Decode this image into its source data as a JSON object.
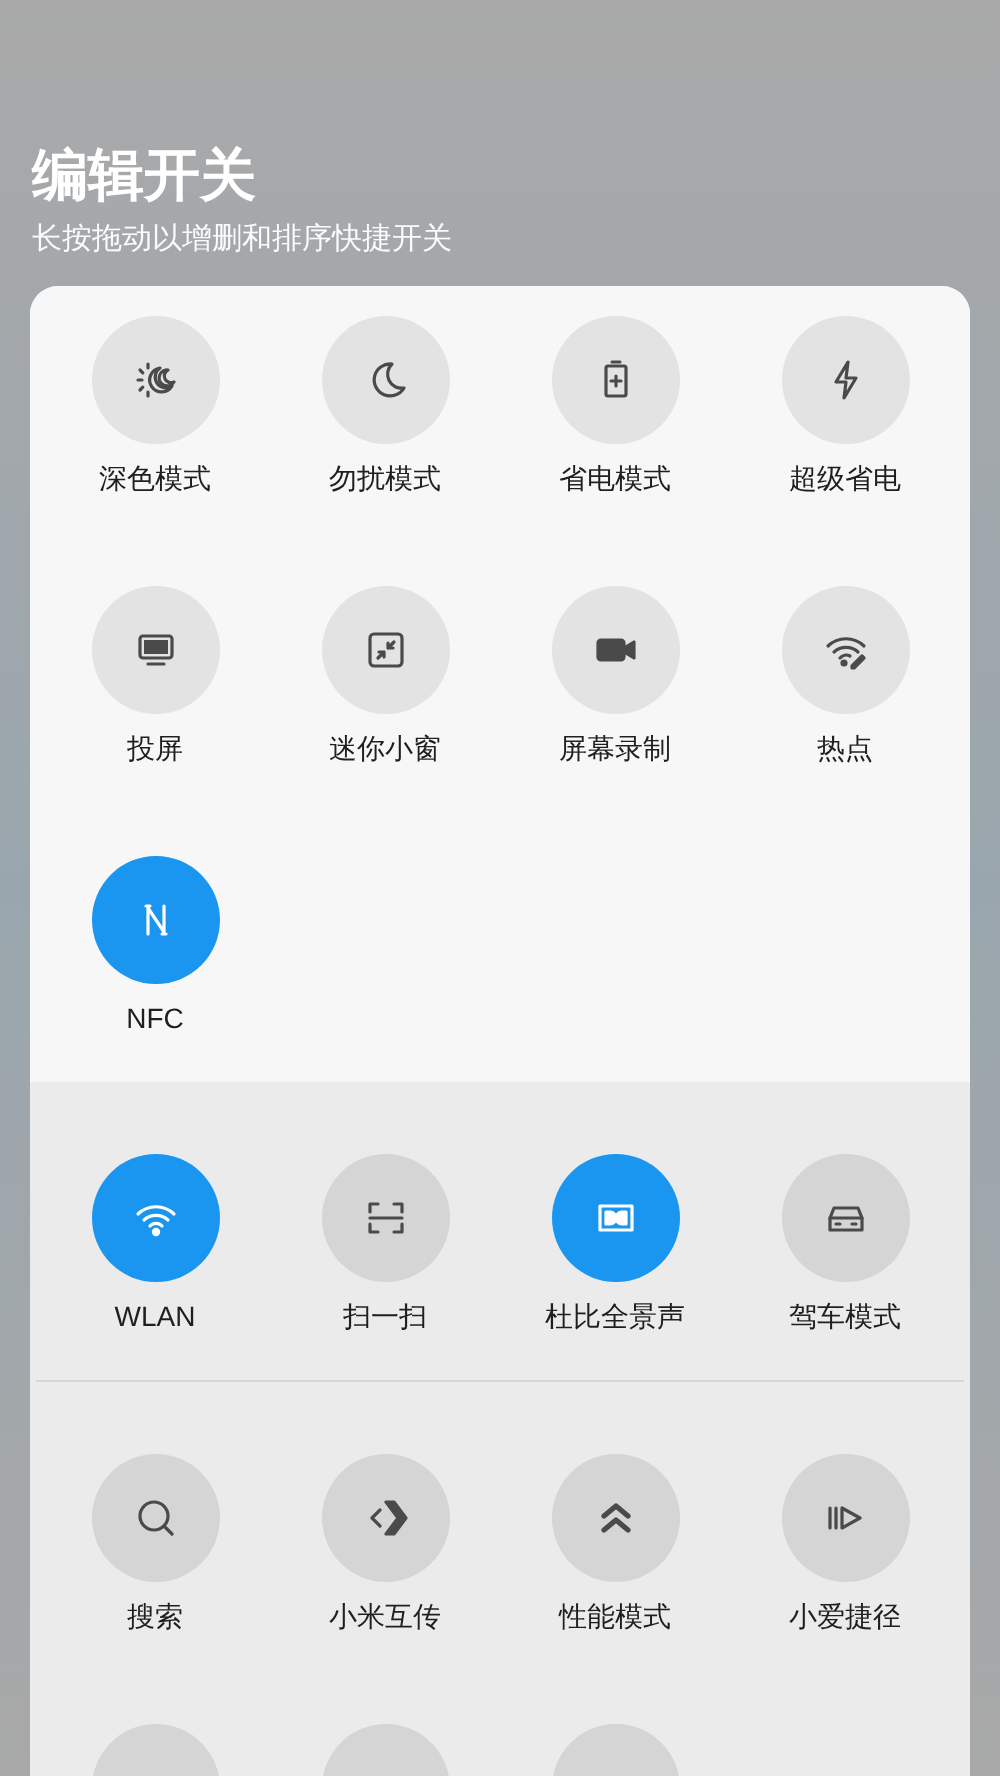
{
  "header": {
    "title": "编辑开关",
    "subtitle": "长按拖动以增删和排序快捷开关"
  },
  "sections": [
    {
      "tiles": [
        {
          "label": "深色模式",
          "on": false
        },
        {
          "label": "勿扰模式",
          "on": false
        },
        {
          "label": "省电模式",
          "on": false
        },
        {
          "label": "超级省电",
          "on": false
        },
        {
          "label": "投屏",
          "on": false
        },
        {
          "label": "迷你小窗",
          "on": false
        },
        {
          "label": "屏幕录制",
          "on": false
        },
        {
          "label": "热点",
          "on": false
        },
        {
          "label": "NFC",
          "on": true
        }
      ]
    },
    {
      "tiles": [
        {
          "label": "WLAN",
          "on": true
        },
        {
          "label": "扫一扫",
          "on": false
        },
        {
          "label": "杜比全景声",
          "on": true
        },
        {
          "label": "驾车模式",
          "on": false
        }
      ]
    },
    {
      "tiles": [
        {
          "label": "搜索",
          "on": false
        },
        {
          "label": "小米互传",
          "on": false
        },
        {
          "label": "性能模式",
          "on": false
        },
        {
          "label": "小爱捷径",
          "on": false
        },
        {
          "on": false
        },
        {
          "on": false
        },
        {
          "on": false
        }
      ]
    }
  ]
}
